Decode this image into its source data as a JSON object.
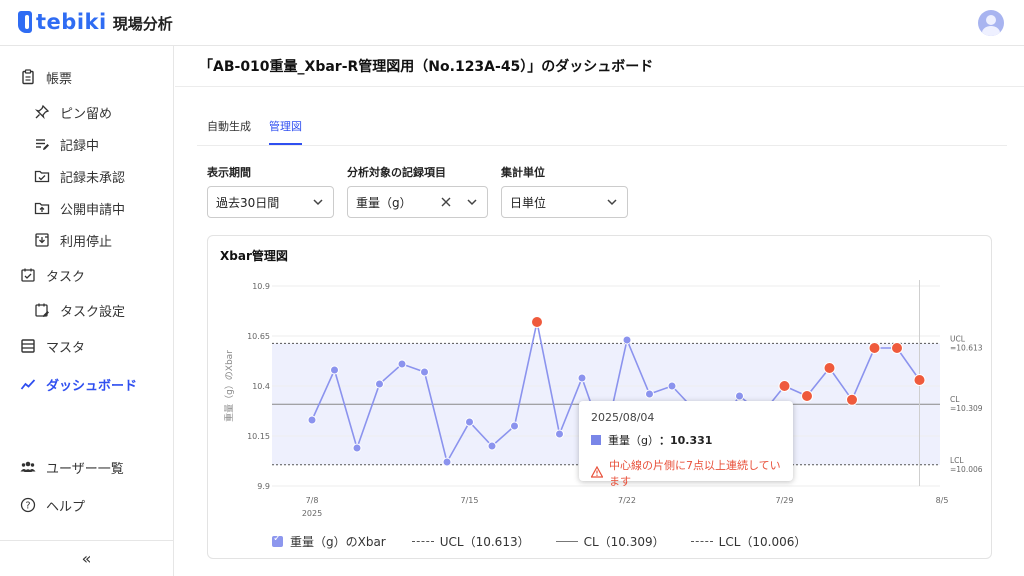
{
  "app": {
    "brand": "tebiki",
    "subtitle": "現場分析"
  },
  "sidebar": {
    "items": [
      {
        "label": "帳票",
        "icon": "clipboard-icon"
      },
      {
        "label": "ピン留め",
        "icon": "pin-icon"
      },
      {
        "label": "記録中",
        "icon": "edit-list-icon"
      },
      {
        "label": "記録未承認",
        "icon": "folder-check-icon"
      },
      {
        "label": "公開申請中",
        "icon": "folder-upload-icon"
      },
      {
        "label": "利用停止",
        "icon": "archive-down-icon"
      },
      {
        "label": "タスク",
        "icon": "task-check-icon"
      },
      {
        "label": "タスク設定",
        "icon": "task-settings-icon"
      },
      {
        "label": "マスタ",
        "icon": "table-icon"
      },
      {
        "label": "ダッシュボード",
        "icon": "chart-line-icon"
      },
      {
        "label": "ユーザー一覧",
        "icon": "users-icon"
      },
      {
        "label": "ヘルプ",
        "icon": "help-icon"
      }
    ],
    "collapse_label": "«"
  },
  "page": {
    "title": "「AB-010重量_Xbar-R管理図用（No.123A-45）」のダッシュボード"
  },
  "tabs": [
    {
      "label": "自動生成"
    },
    {
      "label": "管理図",
      "active": true
    }
  ],
  "filters": {
    "period": {
      "label": "表示期間",
      "value": "過去30日間"
    },
    "item": {
      "label": "分析対象の記録項目",
      "value": "重量（g）"
    },
    "unit": {
      "label": "集計単位",
      "value": "日単位"
    }
  },
  "card": {
    "title": "Xbar管理図"
  },
  "chart_data": {
    "type": "line",
    "ylabel": "重量（g）のXbar",
    "ylim": [
      9.9,
      10.9
    ],
    "yticks": [
      "10.9",
      "10.65",
      "10.4",
      "10.15",
      "9.9"
    ],
    "xtick_labels": [
      "7/8",
      "7/15",
      "7/22",
      "7/29",
      "8/5"
    ],
    "x_year_label": "2025",
    "ucl": 10.613,
    "cl": 10.309,
    "lcl": 10.006,
    "ucl_label": "UCL\n=10.613",
    "cl_label": "CL\n=10.309",
    "lcl_label": "LCL\n=10.006",
    "series": [
      {
        "name": "重量（g）のXbar",
        "x": [
          "7/8",
          "7/9",
          "7/10",
          "7/11",
          "7/12",
          "7/13",
          "7/14",
          "7/15",
          "7/16",
          "7/17",
          "7/18",
          "7/19",
          "7/20",
          "7/21",
          "7/22",
          "7/23",
          "7/24",
          "7/25",
          "7/26",
          "7/27",
          "7/28",
          "7/29",
          "7/30",
          "7/31",
          "8/1",
          "8/2",
          "8/3",
          "8/4",
          "8/5",
          "8/6"
        ],
        "values": [
          10.23,
          10.48,
          10.09,
          10.41,
          10.51,
          10.47,
          10.02,
          10.22,
          10.1,
          10.2,
          10.72,
          10.16,
          10.44,
          10.12,
          10.63,
          10.36,
          10.4,
          10.28,
          10.19,
          10.35,
          10.26,
          10.4,
          10.35,
          10.49,
          10.331,
          10.59,
          10.59,
          10.43,
          null,
          null
        ],
        "violations": [
          false,
          false,
          false,
          false,
          false,
          false,
          false,
          false,
          false,
          false,
          true,
          false,
          false,
          false,
          false,
          false,
          false,
          false,
          false,
          false,
          false,
          true,
          true,
          true,
          true,
          true,
          true,
          true,
          false,
          false
        ]
      }
    ],
    "legend": [
      {
        "label": "重量（g）のXbar"
      },
      {
        "label": "UCL（10.613）"
      },
      {
        "label": "CL（10.309）"
      },
      {
        "label": "LCL（10.006）"
      }
    ],
    "colors": {
      "line": "#8b93ee",
      "point": "#8b93ee",
      "violation": "#ef5a3c",
      "band": "#eef0fd",
      "limit": "#555555"
    }
  },
  "tooltip": {
    "date": "2025/08/04",
    "series_label": "重量（g）",
    "value": "：10.331",
    "warning": "中心線の片側に7点以上連続しています"
  }
}
